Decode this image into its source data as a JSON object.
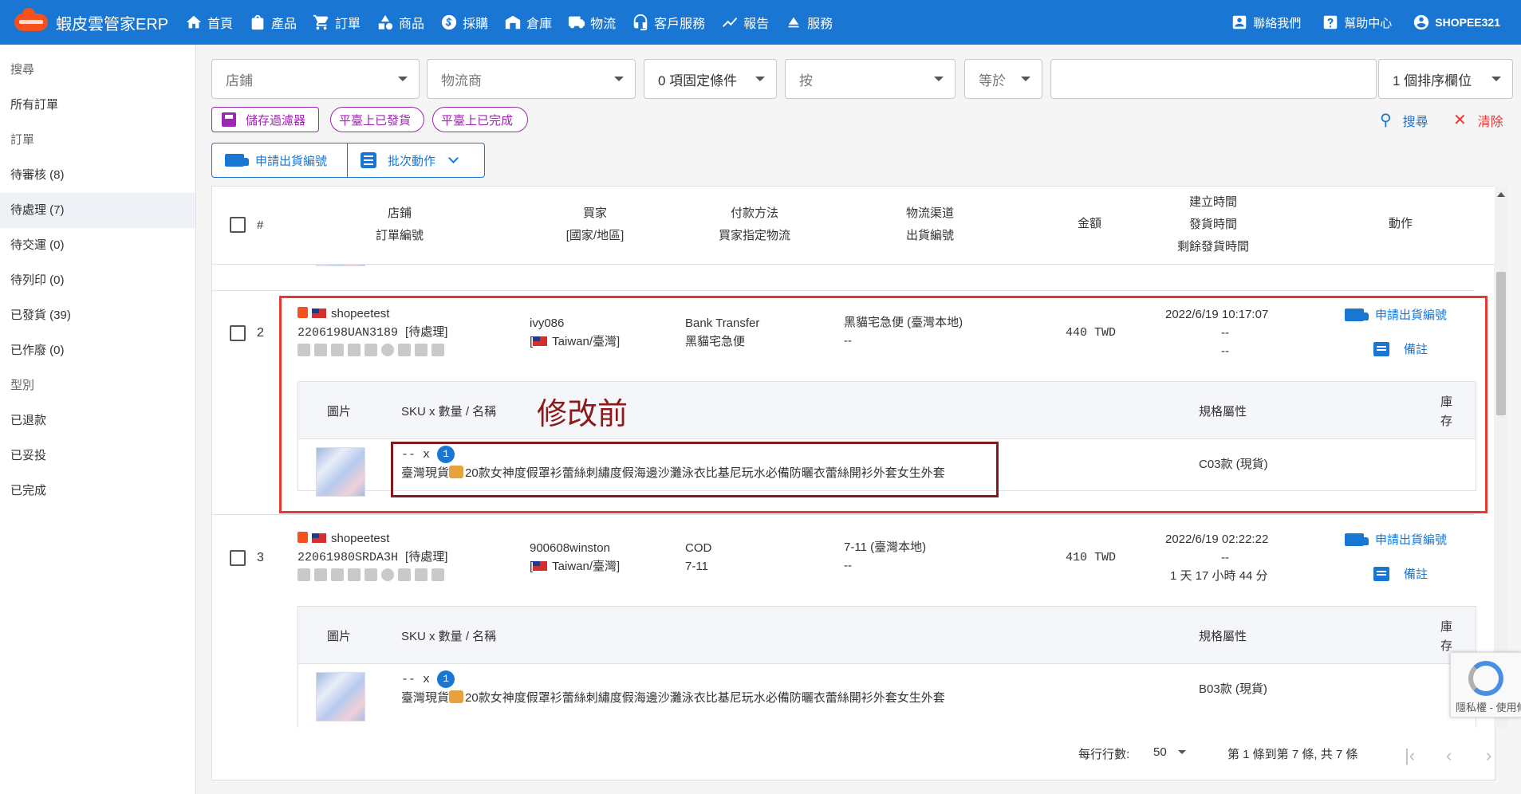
{
  "topbar": {
    "brand": "蝦皮雲管家ERP",
    "nav": [
      {
        "label": "首頁",
        "icon": "home-icon"
      },
      {
        "label": "產品",
        "icon": "bag-icon"
      },
      {
        "label": "訂單",
        "icon": "cart-icon"
      },
      {
        "label": "商品",
        "icon": "shapes-icon"
      },
      {
        "label": "採購",
        "icon": "dollar-icon"
      },
      {
        "label": "倉庫",
        "icon": "warehouse-icon"
      },
      {
        "label": "物流",
        "icon": "truck-icon"
      },
      {
        "label": "客戶服務",
        "icon": "headset-icon"
      },
      {
        "label": "報告",
        "icon": "chart-icon"
      },
      {
        "label": "服務",
        "icon": "eject-icon"
      }
    ],
    "right": [
      {
        "label": "聯絡我們",
        "icon": "contact-icon"
      },
      {
        "label": "幫助中心",
        "icon": "help-icon"
      },
      {
        "label": "SHOPEE321",
        "icon": "account-icon"
      }
    ]
  },
  "sidebar": {
    "items": [
      {
        "label": "搜尋",
        "type": "group"
      },
      {
        "label": "所有訂單",
        "type": "item"
      },
      {
        "label": "訂單",
        "type": "group"
      },
      {
        "label": "待審核 (8)",
        "type": "item"
      },
      {
        "label": "待處理 (7)",
        "type": "item",
        "active": true
      },
      {
        "label": "待交運 (0)",
        "type": "item"
      },
      {
        "label": "待列印 (0)",
        "type": "item"
      },
      {
        "label": "已發貨 (39)",
        "type": "item"
      },
      {
        "label": "已作廢 (0)",
        "type": "item"
      },
      {
        "label": "型別",
        "type": "group"
      },
      {
        "label": "已退款",
        "type": "item"
      },
      {
        "label": "已妥投",
        "type": "item"
      },
      {
        "label": "已完成",
        "type": "item"
      }
    ]
  },
  "filters": {
    "shop": "店鋪",
    "carrier": "物流商",
    "fixed_conditions": "0 項固定條件",
    "by": "按",
    "operator": "等於",
    "value": "",
    "sort": "1 個排序欄位"
  },
  "chips": {
    "save_filter": "儲存過濾器",
    "shipped_on_platform": "平臺上已發貨",
    "completed_on_platform": "平臺上已完成"
  },
  "actions": {
    "search": "搜尋",
    "clear": "清除",
    "request_tracking": "申請出貨編號",
    "batch_action": "批次動作"
  },
  "table": {
    "headers": {
      "num": "#",
      "shop": "店鋪",
      "order_no": "訂單編號",
      "buyer": "買家",
      "country": "[國家/地區]",
      "payment": "付款方法",
      "buyer_logistics": "買家指定物流",
      "channel": "物流渠道",
      "tracking": "出貨編號",
      "amount": "金額",
      "created": "建立時間",
      "shipped": "發貨時間",
      "remaining": "剩餘發貨時間",
      "action": "動作"
    },
    "item_headers": {
      "image": "圖片",
      "sku": "SKU x 數量 / 名稱",
      "spec": "規格屬性",
      "stock": "庫存"
    },
    "rows": [
      {
        "num": "2",
        "shop": "shopeetest",
        "order_no": "2206198UAN3189",
        "status": "[待處理]",
        "buyer": "ivy086",
        "country": "Taiwan/臺灣",
        "payment": "Bank Transfer",
        "buyer_logistics": "黑貓宅急便",
        "channel": "黑貓宅急便 (臺灣本地)",
        "tracking": "--",
        "amount": "440 TWD",
        "created": "2022/6/19 10:17:07",
        "shipped": "--",
        "remaining": "--",
        "action_request": "申請出貨編號",
        "action_note": "備註",
        "item": {
          "sku": "--",
          "x": "x",
          "qty": "1",
          "name_prefix": "臺灣現貨",
          "name": "20款女神度假罩衫蕾絲刺繡度假海邊沙灘泳衣比基尼玩水必備防曬衣蕾絲開衫外套女生外套",
          "spec": "C03款 (現貨)"
        }
      },
      {
        "num": "3",
        "shop": "shopeetest",
        "order_no": "22061980SRDA3H",
        "status": "[待處理]",
        "buyer": "900608winston",
        "country": "Taiwan/臺灣",
        "payment": "COD",
        "buyer_logistics": "7-11",
        "channel": "7-11 (臺灣本地)",
        "tracking": "--",
        "amount": "410 TWD",
        "created": "2022/6/19 02:22:22",
        "shipped": "--",
        "remaining": "1 天 17 小時 44 分",
        "action_request": "申請出貨編號",
        "action_note": "備註",
        "item": {
          "sku": "--",
          "x": "x",
          "qty": "1",
          "name_prefix": "臺灣現貨",
          "name": "20款女神度假罩衫蕾絲刺繡度假海邊沙灘泳衣比基尼玩水必備防曬衣蕾絲開衫外套女生外套",
          "spec": "B03款 (現貨)"
        }
      }
    ]
  },
  "annotation": {
    "label": "修改前",
    "color": "#e53935"
  },
  "pagination": {
    "rows_per_page_label": "每行行數:",
    "rows_per_page": "50",
    "range": "第 1 條到第 7 條, 共 7 條"
  },
  "recaptcha": {
    "text": "隱私權 - 使用條款"
  },
  "colors": {
    "primary": "#1976d2",
    "accent": "#9c27b0",
    "danger": "#e53935"
  }
}
